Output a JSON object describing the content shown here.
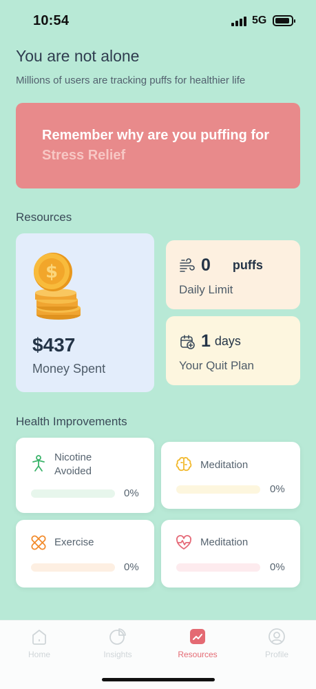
{
  "status": {
    "time": "10:54",
    "network": "5G"
  },
  "header": {
    "title": "You are not alone",
    "subtitle": "Millions of users are tracking puffs for healthier life"
  },
  "reminder": {
    "text": "Remember why are you puffing for",
    "reason": "Stress Relief",
    "color": "#e88a8b"
  },
  "resources": {
    "section_title": "Resources",
    "money": {
      "value": "$437",
      "label": "Money Spent",
      "icon": "coins-icon"
    },
    "daily_limit": {
      "value": "0",
      "unit": "puffs",
      "label": "Daily Limit",
      "icon": "wind-icon"
    },
    "quit_plan": {
      "value": "1",
      "unit": "days",
      "label": "Your Quit Plan",
      "icon": "calendar-plus-icon"
    }
  },
  "health": {
    "section_title": "Health Improvements",
    "items": [
      {
        "label": "Nicotine Avoided",
        "percent": "0%",
        "progress": 0,
        "icon": "person-icon",
        "color": "#3bb36a",
        "track": "#e7f6ec"
      },
      {
        "label": "Meditation",
        "percent": "0%",
        "progress": 0,
        "icon": "brain-icon",
        "color": "#f2b92e",
        "track": "#fdf6de"
      },
      {
        "label": "Exercise",
        "percent": "0%",
        "progress": 0,
        "icon": "bandage-icon",
        "color": "#f28b2c",
        "track": "#fdefe2"
      },
      {
        "label": "Meditation",
        "percent": "0%",
        "progress": 0,
        "icon": "heart-pulse-icon",
        "color": "#e56a78",
        "track": "#fdebee"
      }
    ]
  },
  "tabs": [
    {
      "label": "Home",
      "icon": "home-icon",
      "active": false
    },
    {
      "label": "Insights",
      "icon": "pie-chart-icon",
      "active": false
    },
    {
      "label": "Resources",
      "icon": "trend-icon",
      "active": true
    },
    {
      "label": "Profile",
      "icon": "profile-icon",
      "active": false
    }
  ]
}
